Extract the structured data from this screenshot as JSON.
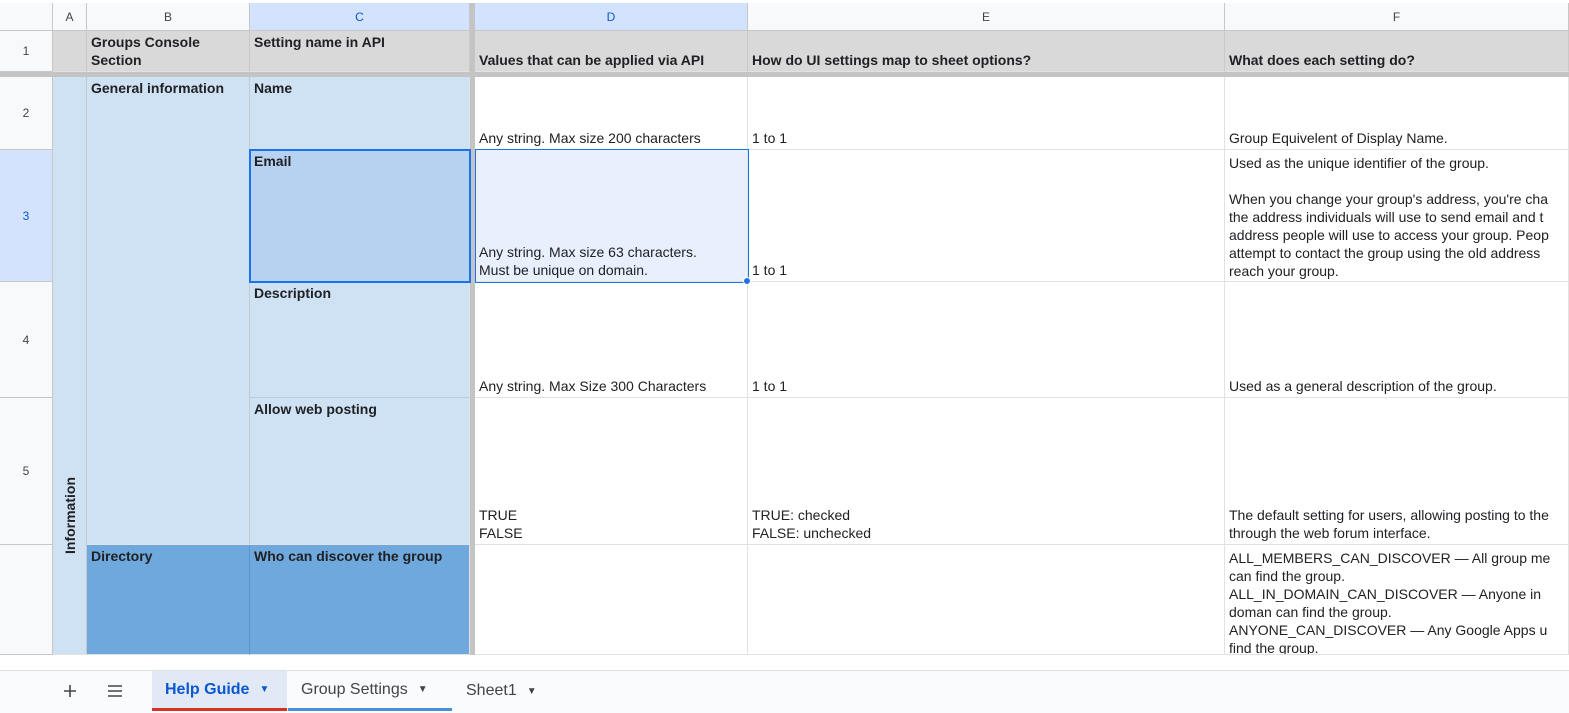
{
  "columns": [
    "A",
    "B",
    "C",
    "D",
    "E",
    "F"
  ],
  "rows": [
    "1",
    "2",
    "3",
    "4",
    "5"
  ],
  "header": {
    "b": "Groups Console\nSection",
    "c": "Setting name in API",
    "d": "Values that can be applied via API",
    "e": "How do UI settings map to sheet options?",
    "f": "What does each setting do?"
  },
  "section_label": "Information",
  "body": [
    {
      "b": "General information",
      "c": "Name",
      "d": "Any string. Max size 200 characters",
      "e": "1 to 1",
      "f": "Group Equivelent of Display Name."
    },
    {
      "b": "",
      "c": "Email",
      "d": "Any string. Max size 63 characters.\nMust be unique on domain.",
      "e": "1 to 1",
      "f": "Used as the unique identifier of the group.\n\nWhen you change your group's address, you're cha\nthe address individuals will use to send email and t\naddress people will use to access your group. Peop\nattempt to contact the group using the old address\nreach your group."
    },
    {
      "b": "",
      "c": "Description",
      "d": "Any string. Max Size 300 Characters",
      "e": "1 to 1",
      "f": "Used as a general description of the group."
    },
    {
      "b": "",
      "c": "Allow web posting",
      "d": "TRUE\nFALSE",
      "e": "TRUE: checked\nFALSE: unchecked",
      "f": "The default setting for users, allowing posting to the\nthrough the web forum interface."
    },
    {
      "b": "Directory",
      "c": "Who can discover the group",
      "d": "",
      "e": "",
      "f": "ALL_MEMBERS_CAN_DISCOVER — All group me\ncan find the group.\nALL_IN_DOMAIN_CAN_DISCOVER — Anyone in\ndoman can find the group.\nANYONE_CAN_DISCOVER — Any Google Apps u\nfind the group."
    }
  ],
  "sheet_tabs": [
    {
      "label": "Help Guide",
      "active": true
    },
    {
      "label": "Group Settings",
      "active": false
    },
    {
      "label": "Sheet1",
      "active": false
    }
  ],
  "icons": {
    "add_sheet": "plus-icon",
    "all_sheets": "menu-icon",
    "tab_menu": "caret-down-icon"
  },
  "colors": {
    "accent": "#1a73e8",
    "section_light": "#cfe2f3",
    "section_dark": "#6fa8dc",
    "header_bg": "#d9d9d9",
    "active_tab_underline": "#d93025"
  }
}
